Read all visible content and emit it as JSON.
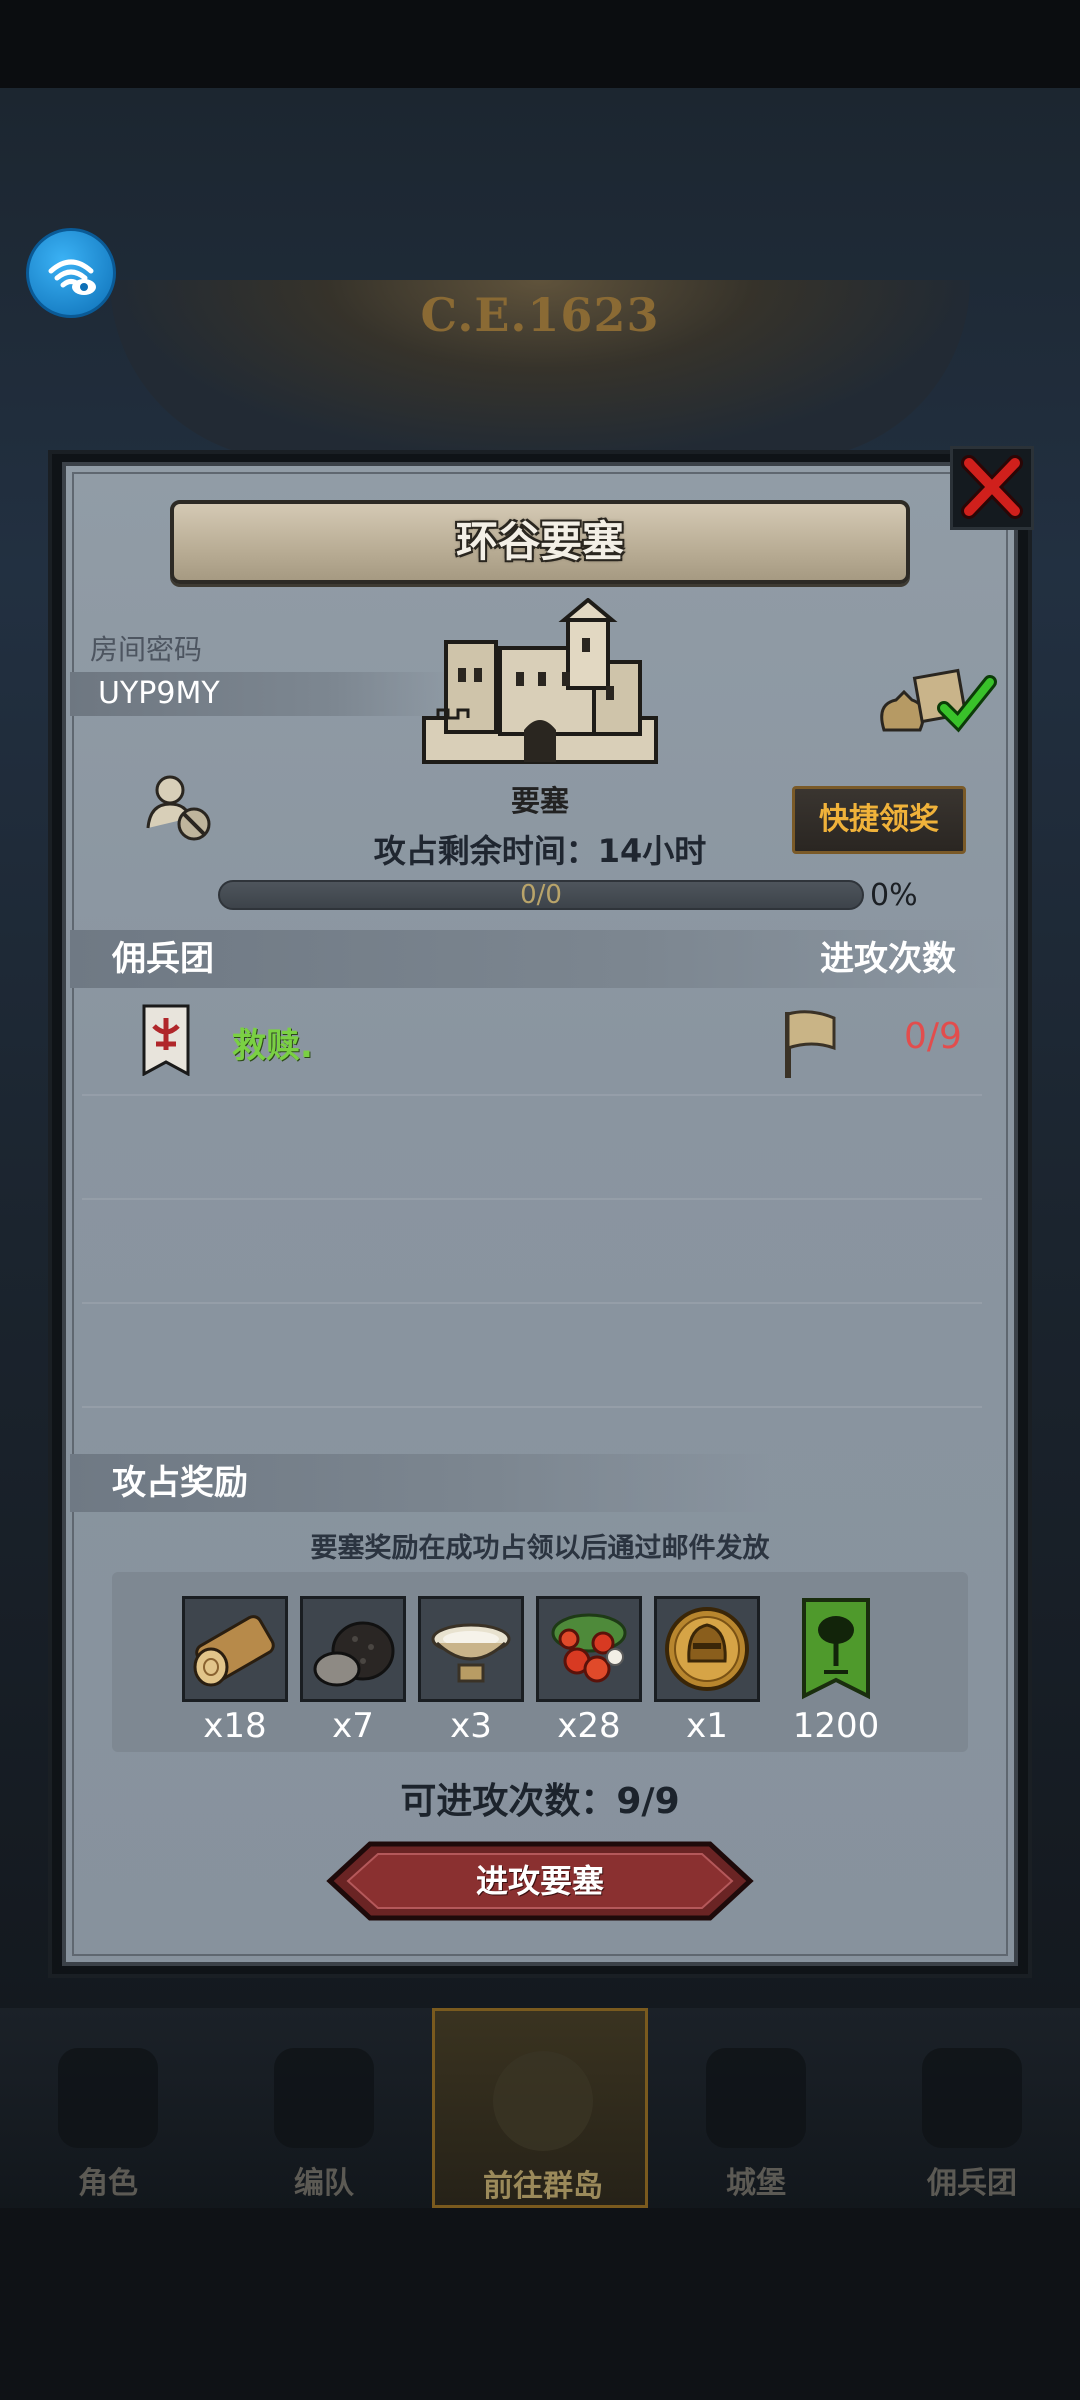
{
  "background": {
    "year": "C.E.1623",
    "nav": [
      {
        "label": "角色"
      },
      {
        "label": "编队"
      },
      {
        "label": "前往群岛"
      },
      {
        "label": "城堡"
      },
      {
        "label": "佣兵团"
      }
    ]
  },
  "dialog": {
    "title": "环谷要塞",
    "room_label": "房间密码",
    "room_code": "UYP9MY",
    "fortress_name": "要塞",
    "remaining_time": "攻占剩余时间：14小时",
    "progress_text": "0/0",
    "progress_percent": "0%",
    "quick_claim_label": "快捷领奖",
    "mercenary_header": "佣兵团",
    "attack_count_header": "进攻次数",
    "mercenaries": [
      {
        "name": "救赎.",
        "attacks": "0/9"
      }
    ],
    "rewards_header": "攻占奖励",
    "rewards_note": "要塞奖励在成功占领以后通过邮件发放",
    "rewards": [
      {
        "icon": "log-icon",
        "qty": "x18"
      },
      {
        "icon": "truffle-icon",
        "qty": "x7"
      },
      {
        "icon": "bowl-icon",
        "qty": "x3"
      },
      {
        "icon": "berries-icon",
        "qty": "x28"
      },
      {
        "icon": "helmet-medal-icon",
        "qty": "x1"
      },
      {
        "icon": "tree-banner-icon",
        "qty": "1200"
      }
    ],
    "available_attacks": "可进攻次数：9/9",
    "attack_button_label": "进攻要塞"
  },
  "colors": {
    "accent_gold": "#f0b23a",
    "merc_name_green": "#7ad043",
    "attack_count_red": "#e24d4d",
    "button_red": "#7a2a2a"
  }
}
